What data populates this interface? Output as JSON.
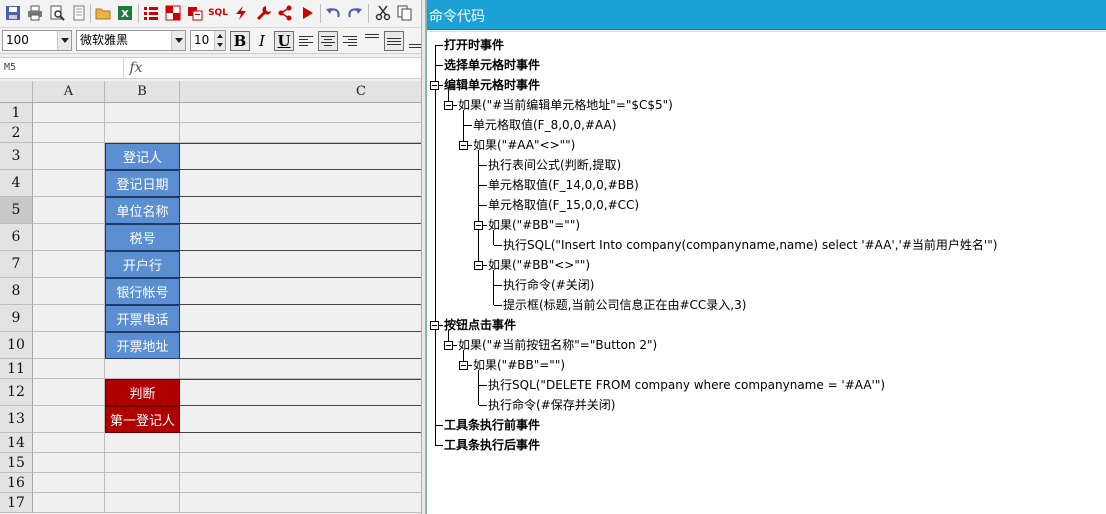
{
  "toolbar": {
    "icons": [
      "save-icon",
      "print-icon",
      "print-preview-icon",
      "page-setup-icon",
      "open-folder-icon",
      "excel-icon",
      "list-icon",
      "merge-cells-icon",
      "copy-format-icon",
      "sql-icon",
      "lightning-icon",
      "wrench-icon",
      "share-icon",
      "run-icon",
      "undo-icon",
      "redo-icon",
      "cut-icon",
      "copy-icon"
    ],
    "sql_label": "SQL"
  },
  "format_bar": {
    "zoom": "100",
    "font_name": "微软雅黑",
    "font_size": "10",
    "bold": "B",
    "italic": "I",
    "underline": "U"
  },
  "formula_bar": {
    "cell_ref": "M5",
    "fx_label": "fx"
  },
  "sheet": {
    "columns": [
      "A",
      "B",
      "C"
    ],
    "rows": [
      "1",
      "2",
      "3",
      "4",
      "5",
      "6",
      "7",
      "8",
      "9",
      "10",
      "11",
      "12",
      "13",
      "14",
      "15",
      "16",
      "17"
    ],
    "selected_row": "5",
    "labels_blue": [
      "登记人",
      "登记日期",
      "单位名称",
      "税号",
      "开户行",
      "银行帐号",
      "开票电话",
      "开票地址"
    ],
    "labels_red": [
      "判断",
      "第一登记人"
    ],
    "colors": {
      "blue": "#5b8fd1",
      "red": "#b00000"
    }
  },
  "panel": {
    "title": "命令代码",
    "tree": [
      {
        "text": "打开时事件"
      },
      {
        "text": "选择单元格时事件"
      },
      {
        "text": "编辑单元格时事件"
      },
      {
        "text": "如果(\"#当前编辑单元格地址\"=\"$C$5\")"
      },
      {
        "text": "单元格取值(F_8,0,0,#AA)"
      },
      {
        "text": "如果(\"#AA\"<>\"\")"
      },
      {
        "text": "执行表间公式(判断,提取)"
      },
      {
        "text": "单元格取值(F_14,0,0,#BB)"
      },
      {
        "text": "单元格取值(F_15,0,0,#CC)"
      },
      {
        "text": "如果(\"#BB\"=\"\")"
      },
      {
        "text": "执行SQL(\"Insert Into company(companyname,name) select '#AA','#当前用户姓名'\")"
      },
      {
        "text": "如果(\"#BB\"<>\"\")"
      },
      {
        "text": "执行命令(#关闭)"
      },
      {
        "text": "提示框(标题,当前公司信息正在由#CC录入,3)"
      },
      {
        "text": "按钮点击事件"
      },
      {
        "text": "如果(\"#当前按钮名称\"=\"Button 2\")"
      },
      {
        "text": "如果(\"#BB\"=\"\")"
      },
      {
        "text": "执行SQL(\"DELETE FROM company where companyname = '#AA'\")"
      },
      {
        "text": "执行命令(#保存并关闭)"
      },
      {
        "text": "工具条执行前事件"
      },
      {
        "text": "工具条执行后事件"
      }
    ]
  }
}
